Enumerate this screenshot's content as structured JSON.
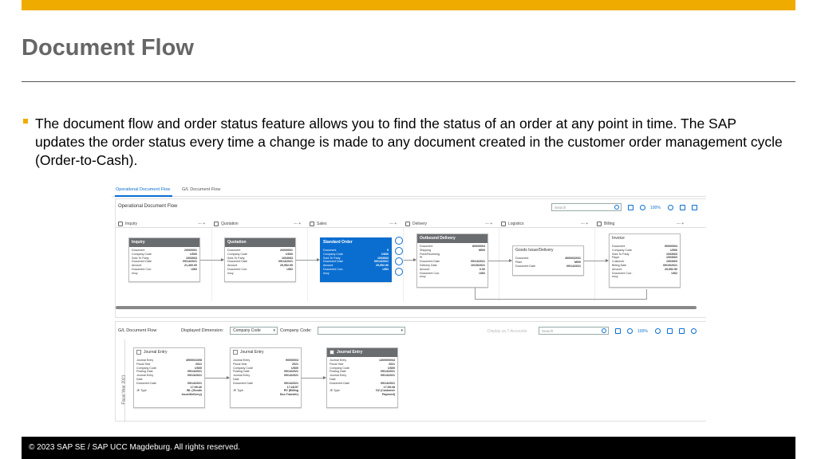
{
  "slide": {
    "title": "Document Flow",
    "body": "The document flow and order status feature allows you to find the status of an order at any point in time. The SAP updates the order status every time a change is made to any document created in the customer order management cycle (Order-to-Cash).",
    "footer": "© 2023 SAP SE / SAP UCC Magdeburg. All rights reserved.",
    "accent_color": "#f0ab00"
  },
  "app": {
    "tabs": [
      {
        "label": "Operational Document Flow",
        "active": true
      },
      {
        "label": "G/L Document Flow",
        "active": false
      }
    ],
    "operational": {
      "title": "Operational Document Flow",
      "search_placeholder": "Search",
      "zoom": "100%",
      "stages": [
        "Inquiry",
        "Quotation",
        "Sales",
        "Delivery",
        "Logistics",
        "Billing"
      ],
      "stage_controls": "--- +",
      "cards": [
        {
          "title": "Inquiry",
          "rows": [
            [
              "Document",
              "20000001"
            ],
            [
              "Company Code",
              "US00"
            ],
            [
              "Sold-To Party",
              "1003063"
            ],
            [
              "Document Date",
              "09/14/2021"
            ],
            [
              "Amount",
              "21,400.00"
            ],
            [
              "Document Curr-",
              "USD"
            ],
            [
              "ency",
              ""
            ]
          ]
        },
        {
          "title": "Quotation",
          "rows": [
            [
              "Document",
              "20000001"
            ],
            [
              "Company Code",
              "US00"
            ],
            [
              "Sold-To Party",
              "1003063"
            ],
            [
              "Document Date",
              "09/14/2021"
            ],
            [
              "Amount",
              "29,952.69"
            ],
            [
              "Document Curr-",
              "USD"
            ],
            [
              "ency",
              ""
            ]
          ]
        },
        {
          "title": "Standard Order",
          "rows": [
            [
              "Document",
              "5"
            ],
            [
              "Company Code",
              "US00"
            ],
            [
              "Sold-To Party",
              "1003063"
            ],
            [
              "Document Date",
              "09/14/2021"
            ],
            [
              "Amount",
              "29,952.90"
            ],
            [
              "Document Curr-",
              "USD"
            ],
            [
              "ency",
              ""
            ]
          ]
        },
        {
          "title": "Outbound Delivery",
          "rows": [
            [
              "Document",
              "80000004"
            ],
            [
              "Shipping",
              "MI00"
            ],
            [
              "Point/Receiving",
              ""
            ],
            [
              "Pt",
              ""
            ],
            [
              "Document Date",
              "09/14/2021"
            ],
            [
              "Delivery Date",
              "10/15/2021"
            ],
            [
              "Amount",
              "0.00"
            ],
            [
              "Document Curr-",
              "USD"
            ],
            [
              "ency",
              ""
            ]
          ]
        },
        {
          "title": "Goods Issue/Delivery",
          "rows": [
            [
              "Document",
              "4900032031"
            ],
            [
              "Plant",
              "MI00"
            ],
            [
              "Document Date",
              "09/14/2021"
            ]
          ]
        },
        {
          "title": "Invoice",
          "rows": [
            [
              "Document",
              "90000004"
            ],
            [
              "Company Code",
              "US00"
            ],
            [
              "Sold-To Party",
              "1003063"
            ],
            [
              "Payer",
              "1003063"
            ],
            [
              "Customer",
              "1003063"
            ],
            [
              "Billing Date",
              "09/19/2021"
            ],
            [
              "Amount",
              "29,952.90"
            ],
            [
              "Document Curr-",
              "USD"
            ],
            [
              "ency",
              ""
            ]
          ]
        }
      ]
    },
    "gl": {
      "title": "G/L Document Flow",
      "displayed_dimension_label": "Displayed Dimension:",
      "displayed_dimension_value": "Company Code",
      "company_code_label": "Company Code:",
      "company_code_value": "",
      "display_as_link": "Display as T-Accounts",
      "search_placeholder": "Search",
      "zoom": "100%",
      "fiscal_year_label": "Fiscal Year 2021",
      "cards": [
        {
          "title": "Journal Entry",
          "rows": [
            [
              "Journal Entry",
              "4900031008"
            ],
            [
              "Fiscal Year",
              "2021"
            ],
            [
              "Company Code",
              "US00"
            ],
            [
              "Posting Date",
              "09/14/2021"
            ],
            [
              "Journal Entry",
              "09/14/2021"
            ],
            [
              "Date",
              ""
            ],
            [
              "Document Date",
              "09/14/2021"
            ],
            [
              "",
              "17:09:40"
            ],
            [
              "JE Type",
              "WL (Goods"
            ],
            [
              "",
              "Issue/Delivery)"
            ]
          ]
        },
        {
          "title": "Journal Entry",
          "rows": [
            [
              "Journal Entry",
              "90000004"
            ],
            [
              "Fiscal Year",
              "2021"
            ],
            [
              "Company Code",
              "US00"
            ],
            [
              "Posting Date",
              "09/14/2021"
            ],
            [
              "Journal Entry",
              "09/14/2021"
            ],
            [
              "Date",
              ""
            ],
            [
              "Document Date",
              "09/14/2021"
            ],
            [
              "",
              "17:28:57"
            ],
            [
              "JE Type",
              "RV (Billing"
            ],
            [
              "",
              "Doc.Transfer)"
            ]
          ]
        },
        {
          "title": "Journal Entry",
          "rows": [
            [
              "Journal Entry",
              "1400000034"
            ],
            [
              "Fiscal Year",
              "2021"
            ],
            [
              "Company Code",
              "US00"
            ],
            [
              "Posting Date",
              "09/14/2021"
            ],
            [
              "Journal Entry",
              "09/14/2021"
            ],
            [
              "Date",
              ""
            ],
            [
              "Document Date",
              "09/14/2021"
            ],
            [
              "",
              "17:09:28"
            ],
            [
              "JE Type",
              "DZ (Customer"
            ],
            [
              "",
              "Payment)"
            ]
          ]
        }
      ]
    }
  }
}
